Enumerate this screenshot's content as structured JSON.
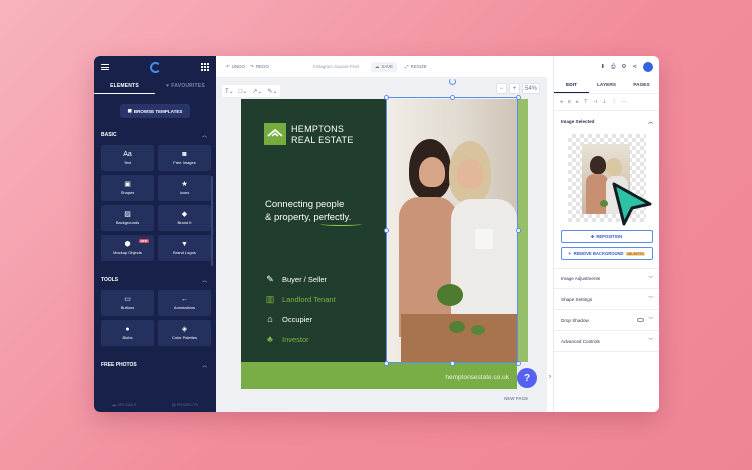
{
  "sidebar": {
    "tabs": [
      {
        "label": "ELEMENTS"
      },
      {
        "label": "FAVOURITES"
      }
    ],
    "browse_button": "BROWSE TEMPLATES",
    "basic": {
      "title": "BASIC",
      "items": [
        {
          "label": "Text",
          "icon": "text-icon"
        },
        {
          "label": "Free Images",
          "icon": "camera-icon"
        },
        {
          "label": "Shapes",
          "icon": "shapes-icon"
        },
        {
          "label": "Icons",
          "icon": "star-icon"
        },
        {
          "label": "Backgrounds",
          "icon": "backgrounds-icon"
        },
        {
          "label": "Brand It",
          "icon": "brand-tag-icon"
        },
        {
          "label": "Mockup Objects",
          "icon": "cube-icon",
          "badge": "NEW"
        },
        {
          "label": "Brand Logos",
          "icon": "brand-logo-icon"
        }
      ]
    },
    "tools": {
      "title": "TOOLS",
      "items": [
        {
          "label": "Buttons",
          "icon": "button-icon"
        },
        {
          "label": "Annotations",
          "icon": "arrow-left-icon"
        },
        {
          "label": "Blobs",
          "icon": "blob-icon"
        },
        {
          "label": "Color Palettes",
          "icon": "palette-icon"
        }
      ]
    },
    "free_photos": {
      "title": "FREE PHOTOS"
    },
    "bottom": {
      "uploads": "UPLOADS",
      "projects": "PROJECTS"
    }
  },
  "topbar": {
    "undo": "UNDO",
    "redo": "REDO",
    "doc_title": "Instagram Square Post",
    "save": "SAVE",
    "resize": "RESIZE"
  },
  "canvas": {
    "zoom": "54%",
    "new_page": "NEW PAGE",
    "design": {
      "brand_line1": "HEMPTONS",
      "brand_line2": "REAL ESTATE",
      "tagline_line1": "Connecting people",
      "tagline_line2_a": "& property, ",
      "tagline_line2_b": "perfectly.",
      "roles": [
        {
          "label": "Buyer / Seller",
          "color": "#ffffff"
        },
        {
          "label": "Landlord Tenant",
          "color": "#7fb247"
        },
        {
          "label": "Occupier",
          "color": "#ffffff"
        },
        {
          "label": "Investor",
          "color": "#7fb247"
        }
      ],
      "url": "hemptonsestate.co.uk",
      "colors": {
        "dark_green": "#213d2e",
        "accent_green": "#79ad46"
      }
    }
  },
  "right_panel": {
    "tabs": [
      {
        "label": "EDIT"
      },
      {
        "label": "LAYERS"
      },
      {
        "label": "PAGES"
      }
    ],
    "section_title": "Image Selected",
    "reposition": "REPOSITION",
    "remove_bg": "REMOVE BACKGROUND",
    "remove_bg_badge": "UNLIMITED",
    "sections": [
      {
        "label": "Image Adjustments"
      },
      {
        "label": "Shape Settings"
      },
      {
        "label": "Drop Shadow"
      },
      {
        "label": "Advanced Controls"
      }
    ]
  },
  "help": "?"
}
